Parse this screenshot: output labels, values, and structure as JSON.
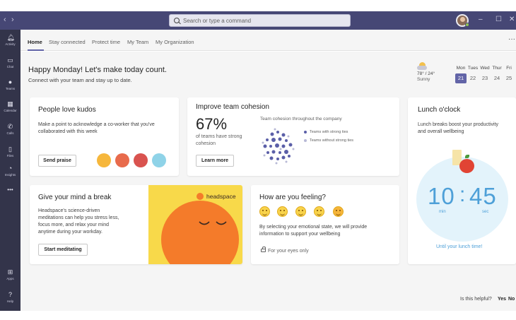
{
  "titlebar": {
    "search_placeholder": "Search or type a command",
    "back_icon": "chevron-left-icon",
    "forward_icon": "chevron-right-icon",
    "more_label": "···",
    "minimize_label": "–",
    "maximize_label": "☐",
    "close_label": "✕"
  },
  "rail": {
    "items": [
      {
        "label": "Activity",
        "icon": "bell-icon"
      },
      {
        "label": "Chat",
        "icon": "chat-icon"
      },
      {
        "label": "Teams",
        "icon": "teams-icon"
      },
      {
        "label": "Calendar",
        "icon": "calendar-icon"
      },
      {
        "label": "Calls",
        "icon": "phone-icon"
      },
      {
        "label": "Files",
        "icon": "file-icon"
      },
      {
        "label": "Insights",
        "icon": "insights-icon"
      },
      {
        "label": "Apps",
        "icon": "apps-icon"
      },
      {
        "label": "Help",
        "icon": "help-icon"
      }
    ],
    "more_label": "•••"
  },
  "tabs": [
    {
      "label": "Home"
    },
    {
      "label": "Stay connected"
    },
    {
      "label": "Protect time"
    },
    {
      "label": "My Team"
    },
    {
      "label": "My Organization"
    }
  ],
  "tabs_more": "···",
  "header": {
    "greeting": "Happy Monday! Let's make today count.",
    "subtitle": "Connect with your team and stay up to date."
  },
  "weather": {
    "temp": "78° / 24°",
    "condition": "Sunny",
    "icon": "sun-cloud-icon"
  },
  "calendar": {
    "days": [
      "Mon",
      "Tues",
      "Wed",
      "Thur",
      "Fri"
    ],
    "dates": [
      "21",
      "22",
      "23",
      "24",
      "25"
    ],
    "selected_index": 0
  },
  "kudos": {
    "title": "People love kudos",
    "text_line1": "Make a point to acknowledge a co-worker that you've",
    "text_line2": "collaborated with this week",
    "button": "Send praise",
    "badge_colors": [
      "#f6b73c",
      "#e86b4c",
      "#d9534f",
      "#8fd3e8"
    ]
  },
  "cohesion": {
    "title": "Improve team cohesion",
    "percent": "67%",
    "caption_line1": "of teams have strong",
    "caption_line2": "cohesion",
    "button": "Learn more",
    "chart_title": "Team cohesion throughout the company",
    "legend": [
      {
        "label": "Teams with strong ties",
        "color": "#5b5fa8"
      },
      {
        "label": "Teams without strong ties",
        "color": "#b8b9d6"
      }
    ]
  },
  "lunch": {
    "title": "Lunch o'clock",
    "text_line1": "Lunch breaks boost your productivity",
    "text_line2": "and overall wellbeing",
    "minutes": "10",
    "seconds": "45",
    "min_label": "min",
    "sec_label": "sec",
    "link": "Until your lunch time!"
  },
  "mind": {
    "title": "Give your mind a break",
    "lines": [
      "Headspace's science-driven",
      "meditations can help you stress less,",
      "focus more, and relax your mind",
      "anytime during your workday."
    ],
    "button": "Start meditating",
    "brand": "headspace"
  },
  "feeling": {
    "title": "How are you feeling?",
    "text_line1": "By selecting your emotional state, we will provide",
    "text_line2": "information to support your wellbeing",
    "privacy": "For your eyes only",
    "emoji_names": [
      "grinning-emoji",
      "smiling-emoji",
      "neutral-emoji",
      "sad-emoji",
      "frustrated-emoji"
    ]
  },
  "footer": {
    "question": "Is this helpful?",
    "yes": "Yes",
    "no": "No"
  }
}
